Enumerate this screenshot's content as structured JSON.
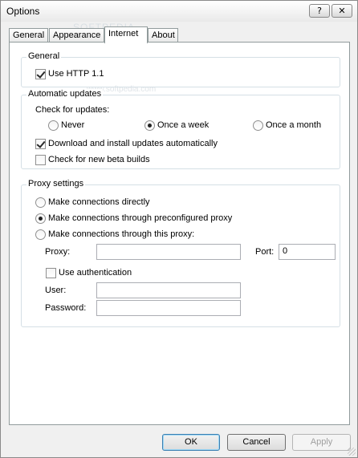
{
  "window": {
    "title": "Options",
    "help_label": "?",
    "close_label": "✕"
  },
  "watermark": {
    "line1": "SOFTPEDIA",
    "line2": "www.softpedia.com"
  },
  "tabs": [
    {
      "label": "General"
    },
    {
      "label": "Appearance"
    },
    {
      "label": "Internet"
    },
    {
      "label": "About"
    }
  ],
  "general": {
    "heading": "General",
    "use_http11": "Use HTTP 1.1"
  },
  "updates": {
    "heading": "Automatic updates",
    "check_label": "Check for updates:",
    "options": [
      "Never",
      "Once a week",
      "Once a month"
    ],
    "download_auto": "Download and install updates automatically",
    "beta": "Check for new beta builds"
  },
  "proxy": {
    "heading": "Proxy settings",
    "direct": "Make connections directly",
    "preconfigured": "Make connections through preconfigured proxy",
    "this_proxy": "Make connections through this proxy:",
    "proxy_label": "Proxy:",
    "port_label": "Port:",
    "port_value": "0",
    "proxy_value": "",
    "use_auth": "Use authentication",
    "user_label": "User:",
    "password_label": "Password:",
    "user_value": "",
    "password_value": ""
  },
  "buttons": {
    "ok": "OK",
    "cancel": "Cancel",
    "apply": "Apply"
  }
}
